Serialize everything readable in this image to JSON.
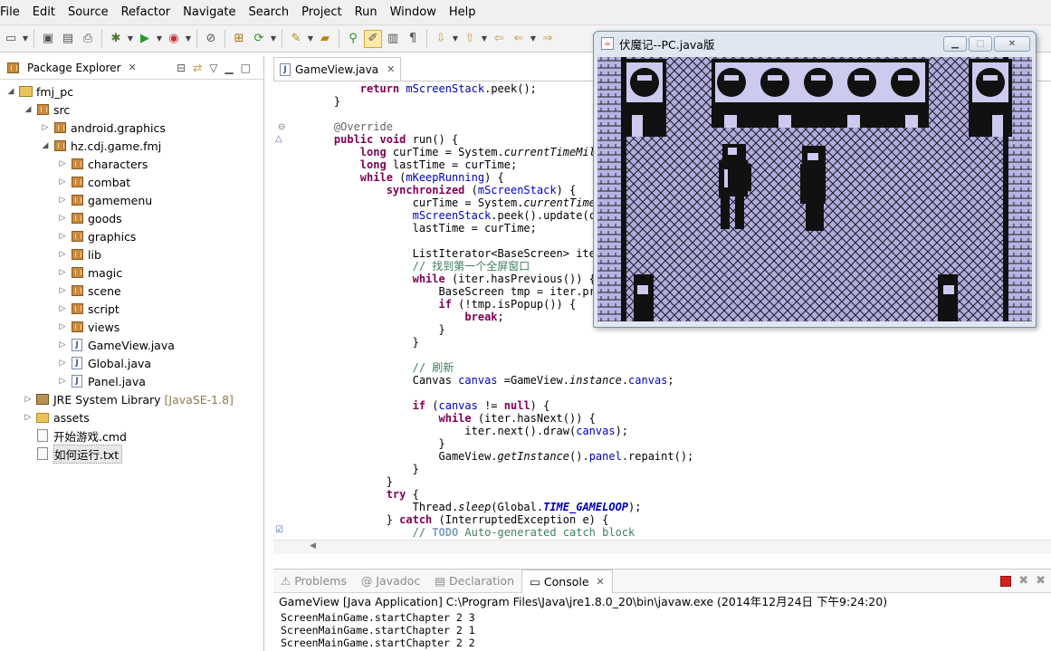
{
  "menu": [
    "File",
    "Edit",
    "Source",
    "Refactor",
    "Navigate",
    "Search",
    "Project",
    "Run",
    "Window",
    "Help"
  ],
  "package_explorer": {
    "title": "Package Explorer",
    "tree": [
      {
        "label": "fmj_pc",
        "type": "project",
        "depth": 0,
        "expanded": true
      },
      {
        "label": "src",
        "type": "srcfolder",
        "depth": 1,
        "expanded": true
      },
      {
        "label": "android.graphics",
        "type": "package",
        "depth": 2,
        "expanded": false
      },
      {
        "label": "hz.cdj.game.fmj",
        "type": "package",
        "depth": 2,
        "expanded": true
      },
      {
        "label": "characters",
        "type": "package",
        "depth": 3,
        "expanded": false
      },
      {
        "label": "combat",
        "type": "package",
        "depth": 3,
        "expanded": false
      },
      {
        "label": "gamemenu",
        "type": "package",
        "depth": 3,
        "expanded": false
      },
      {
        "label": "goods",
        "type": "package",
        "depth": 3,
        "expanded": false
      },
      {
        "label": "graphics",
        "type": "package",
        "depth": 3,
        "expanded": false
      },
      {
        "label": "lib",
        "type": "package",
        "depth": 3,
        "expanded": false
      },
      {
        "label": "magic",
        "type": "package",
        "depth": 3,
        "expanded": false
      },
      {
        "label": "scene",
        "type": "package",
        "depth": 3,
        "expanded": false
      },
      {
        "label": "script",
        "type": "package",
        "depth": 3,
        "expanded": false
      },
      {
        "label": "views",
        "type": "package",
        "depth": 3,
        "expanded": false
      },
      {
        "label": "GameView.java",
        "type": "java",
        "depth": 3,
        "expanded": false
      },
      {
        "label": "Global.java",
        "type": "java",
        "depth": 3,
        "expanded": false
      },
      {
        "label": "Panel.java",
        "type": "java",
        "depth": 3,
        "expanded": false
      },
      {
        "label": "JRE System Library",
        "type": "library",
        "depth": 1,
        "expanded": false,
        "decoration": "[JavaSE-1.8]"
      },
      {
        "label": "assets",
        "type": "folder",
        "depth": 1,
        "expanded": false
      },
      {
        "label": "开始游戏.cmd",
        "type": "file",
        "depth": 1,
        "expanded": null
      },
      {
        "label": "如何运行.txt",
        "type": "file",
        "depth": 1,
        "expanded": null,
        "selected": true
      }
    ]
  },
  "editor": {
    "tab_label": "GameView.java",
    "code_lines": [
      "        return mScreenStack.peek();",
      "    }",
      "",
      "    @Override",
      "    public void run() {",
      "        long curTime = System.currentTimeMillis();",
      "        long lastTime = curTime;",
      "        while (mKeepRunning) {",
      "            synchronized (mScreenStack) {",
      "                curTime = System.currentTimeMillis();",
      "                mScreenStack.peek().update(curTime - lastTime);",
      "                lastTime = curTime;",
      "",
      "                ListIterator<BaseScreen> iter = mScreenStack.listIterator(mScreenStack.size());",
      "                // 找到第一个全屏窗口",
      "                while (iter.hasPrevious()) {",
      "                    BaseScreen tmp = iter.previous();",
      "                    if (!tmp.isPopup()) {",
      "                        break;",
      "                    }",
      "                }",
      "",
      "                // 刷新",
      "                Canvas canvas =GameView.instance.canvas;",
      "",
      "                if (canvas != null) {",
      "                    while (iter.hasNext()) {",
      "                        iter.next().draw(canvas);",
      "                    }",
      "                    GameView.getInstance().panel.repaint();",
      "                }",
      "            }",
      "            try {",
      "                Thread.sleep(Global.TIME_GAMELOOP);",
      "            } catch (InterruptedException e) {",
      "                // TODO Auto-generated catch block"
    ]
  },
  "console": {
    "tabs": [
      "Problems",
      "Javadoc",
      "Declaration",
      "Console"
    ],
    "active_tab": "Console",
    "description": "GameView [Java Application] C:\\Program Files\\Java\\jre1.8.0_20\\bin\\javaw.exe (2014年12月24日 下午9:24:20)",
    "lines": [
      "ScreenMainGame.startChapter 2 3",
      "ScreenMainGame.startChapter 2 1",
      "ScreenMainGame.startChapter 2 2"
    ]
  },
  "game_window": {
    "title": "伏魔记--PC.java版",
    "bg_color": "#a9a5dd"
  }
}
